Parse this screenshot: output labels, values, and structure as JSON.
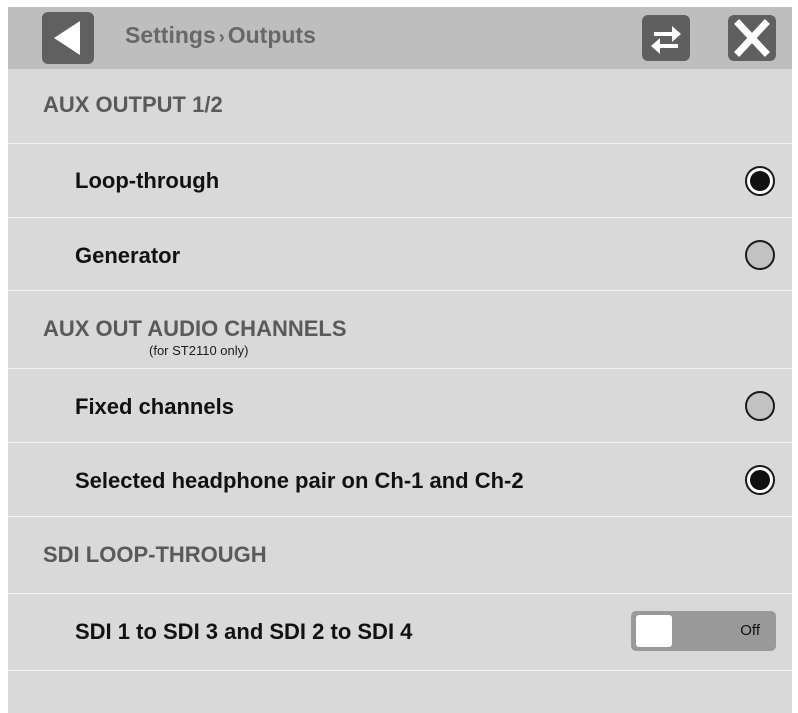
{
  "header": {
    "breadcrumb_parent": "Settings",
    "breadcrumb_separator": "›",
    "breadcrumb_current": "Outputs",
    "back_icon": "back-triangle-icon",
    "swap_icon": "swap-arrows-icon",
    "close_icon": "close-x-icon"
  },
  "sections": {
    "aux_output": {
      "title": "AUX OUTPUT 1/2",
      "options": [
        {
          "label": "Loop-through",
          "selected": true
        },
        {
          "label": "Generator",
          "selected": false
        }
      ]
    },
    "aux_audio": {
      "title": "AUX OUT AUDIO CHANNELS",
      "subtitle": "(for ST2110 only)",
      "options": [
        {
          "label": "Fixed channels",
          "selected": false
        },
        {
          "label": "Selected headphone pair on Ch-1 and Ch-2",
          "selected": true
        }
      ]
    },
    "sdi_loop": {
      "title": "SDI LOOP-THROUGH",
      "toggle_label": "SDI 1 to SDI 3 and SDI 2 to SDI 4",
      "toggle_state": "Off"
    }
  },
  "colors": {
    "background": "#d9d9d9",
    "header": "#bebebe",
    "button": "#5f5f5f",
    "separator": "#f2f2f2"
  }
}
